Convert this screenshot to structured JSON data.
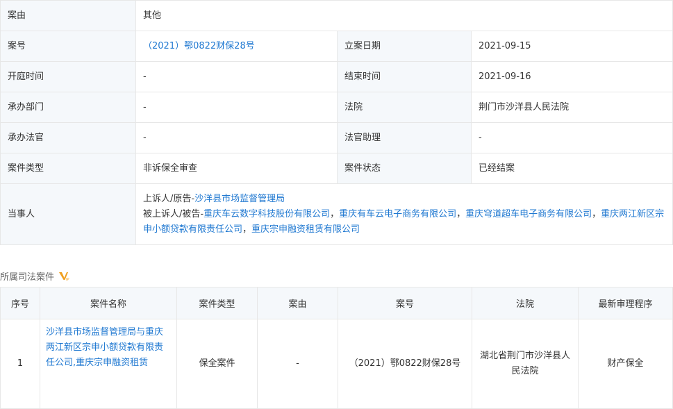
{
  "info": {
    "cause_label": "案由",
    "cause_value": "其他",
    "case_no_label": "案号",
    "case_no_value": "（2021）鄂0822财保28号",
    "filing_date_label": "立案日期",
    "filing_date_value": "2021-09-15",
    "hearing_label": "开庭时间",
    "hearing_value": "-",
    "end_label": "结束时间",
    "end_value": "2021-09-16",
    "dept_label": "承办部门",
    "dept_value": "-",
    "court_label": "法院",
    "court_value": "荆门市沙洋县人民法院",
    "judge_label": "承办法官",
    "judge_value": "-",
    "assistant_label": "法官助理",
    "assistant_value": "-",
    "type_label": "案件类型",
    "type_value": "非诉保全审查",
    "status_label": "案件状态",
    "status_value": "已经结案",
    "parties_label": "当事人",
    "plaintiff_prefix": "上诉人/原告-",
    "plaintiff": "沙洋县市场监督管理局",
    "defendant_prefix": "被上诉人/被告-",
    "defendants": [
      "重庆车云数字科技股份有限公司",
      "重庆有车云电子商务有限公司",
      "重庆穹道超车电子商务有限公司",
      "重庆两江新区宗申小额贷款有限责任公司",
      "重庆宗申融资租赁有限公司"
    ],
    "separator": "，"
  },
  "section": {
    "title": "所属司法案件",
    "vip_icon": "vip-icon"
  },
  "cases": {
    "headers": [
      "序号",
      "案件名称",
      "案件类型",
      "案由",
      "案号",
      "法院",
      "最新审理程序"
    ],
    "rows": [
      {
        "index": "1",
        "name": "沙洋县市场监督管理局与重庆两江新区宗申小额贷款有限责任公司,重庆宗申融资租赁",
        "type": "保全案件",
        "cause": "-",
        "case_no": "（2021）鄂0822财保28号",
        "court": "湖北省荆门市沙洋县人民法院",
        "procedure": "财产保全"
      }
    ]
  },
  "colors": {
    "link": "#1f78d1",
    "label_bg": "#f5f8fb",
    "border": "#e7e7e7",
    "vip": "#f0a020"
  }
}
